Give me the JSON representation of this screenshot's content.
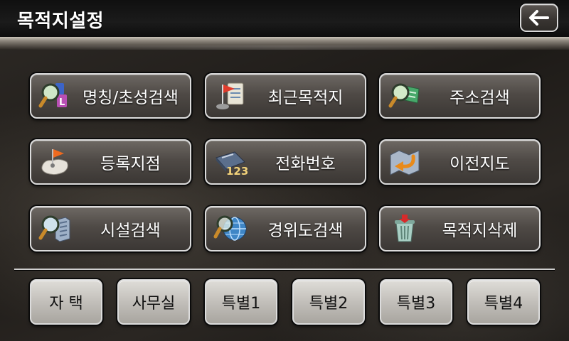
{
  "header": {
    "title": "목적지설정",
    "back_icon": "arrow-left-icon"
  },
  "menu": [
    {
      "label": "명칭/초성검색",
      "icon": "magnifier-text-icon"
    },
    {
      "label": "최근목적지",
      "icon": "flag-notepad-icon"
    },
    {
      "label": "주소검색",
      "icon": "magnifier-book-icon"
    },
    {
      "label": "등록지점",
      "icon": "flag-map-icon"
    },
    {
      "label": "전화번호",
      "icon": "phonebook-icon"
    },
    {
      "label": "이전지도",
      "icon": "map-return-icon"
    },
    {
      "label": "시설검색",
      "icon": "magnifier-building-icon"
    },
    {
      "label": "경위도검색",
      "icon": "magnifier-globe-icon"
    },
    {
      "label": "목적지삭제",
      "icon": "trash-icon"
    }
  ],
  "favorites": [
    {
      "label": "자 택"
    },
    {
      "label": "사무실"
    },
    {
      "label": "특별1"
    },
    {
      "label": "특별2"
    },
    {
      "label": "특별3"
    },
    {
      "label": "특별4"
    }
  ],
  "colors": {
    "background": "#24211e",
    "header": "#141414",
    "button_dark": "#4f4a46",
    "button_light": "#c2bfba",
    "border": "#dcdcdc"
  }
}
